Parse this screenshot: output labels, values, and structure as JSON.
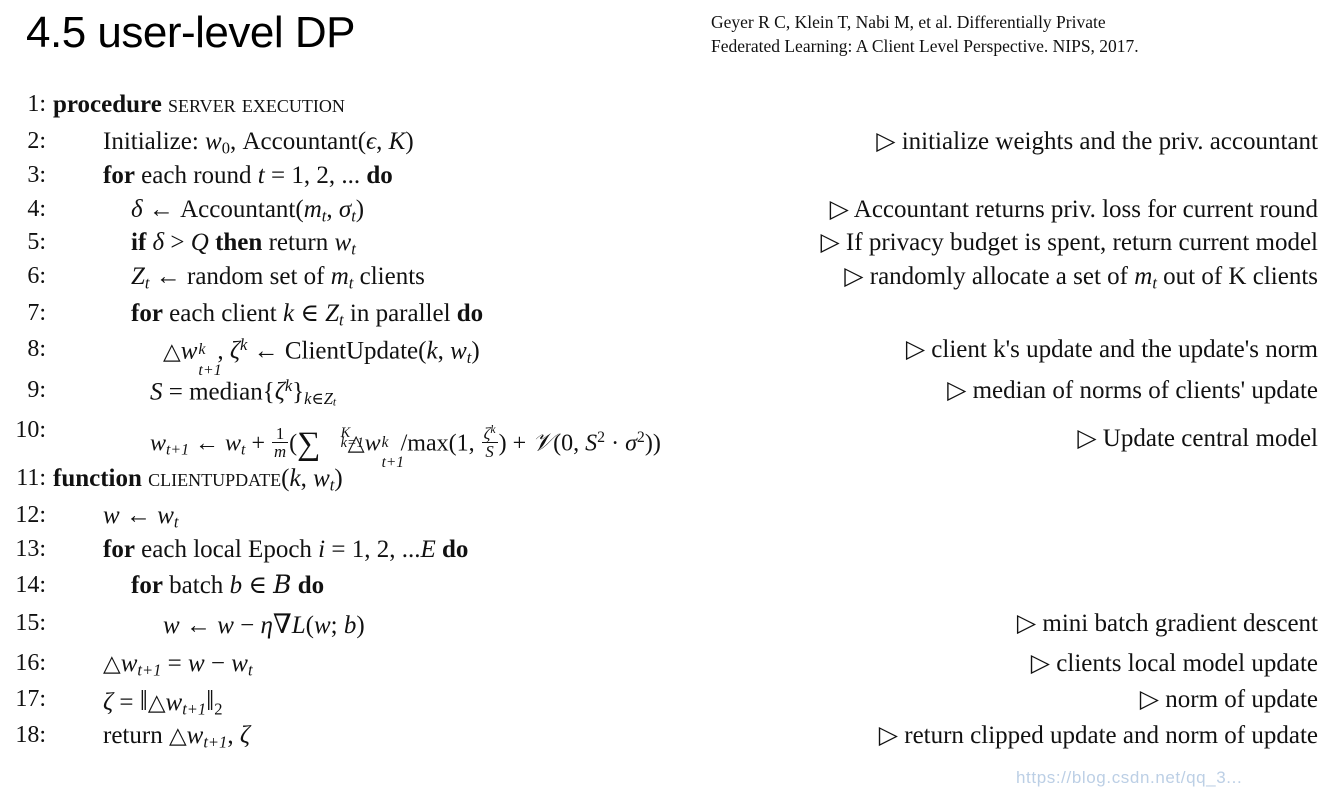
{
  "header": {
    "title": "4.5 user-level DP",
    "citation": [
      "Geyer R C, Klein T, Nabi M, et al. Differentially Private",
      "Federated Learning: A Client Level Perspective. NIPS, 2017."
    ]
  },
  "watermark": {
    "text": "https://blog.csdn.net/qq_3..."
  },
  "algorithm": {
    "name": "Server execution / ClientUpdate",
    "comment_marker": "▷",
    "lines": [
      {
        "no": "1:",
        "indent": 53,
        "code_text": "procedure Server execution",
        "comment": ""
      },
      {
        "no": "2:",
        "indent": 103,
        "code_text": "Initialize: w0, Accountant(ϵ, K)",
        "comment": "▷ initialize weights and the priv. accountant"
      },
      {
        "no": "3:",
        "indent": 103,
        "code_text": "for each round t = 1, 2, ... do",
        "comment": ""
      },
      {
        "no": "4:",
        "indent": 131,
        "code_text": "δ ← Accountant(mt, σt)",
        "comment": "▷ Accountant returns priv. loss for current round"
      },
      {
        "no": "5:",
        "indent": 131,
        "code_text": "if δ > Q then return wt",
        "comment": "▷ If privacy budget is spent, return current model"
      },
      {
        "no": "6:",
        "indent": 131,
        "code_text": "Zt ← random set of mt clients",
        "comment": "▷ randomly allocate a set of mt out of K clients"
      },
      {
        "no": "7:",
        "indent": 131,
        "code_text": "for each client k ∈ Zt in parallel do",
        "comment": ""
      },
      {
        "no": "8:",
        "indent": 163,
        "code_text": "△wkt+1, ζk ← ClientUpdate(k, wt)",
        "comment": "▷ client k's update and the update's norm"
      },
      {
        "no": "9:",
        "indent": 150,
        "code_text": "S = median{ζk}k∈Zt",
        "comment": "▷ median of norms of clients' update"
      },
      {
        "no": "10:",
        "indent": 150,
        "code_text": "wt+1 ← wt + 1/m(∑Kk=1 △wkt+1/max(1, ζk/S) + N(0, S2 · σ2))",
        "comment": "▷ Update central model"
      },
      {
        "no": "11:",
        "indent": 53,
        "code_text": "function ClientUpdate(k, wt)",
        "comment": ""
      },
      {
        "no": "12:",
        "indent": 103,
        "code_text": "w ← wt",
        "comment": ""
      },
      {
        "no": "13:",
        "indent": 103,
        "code_text": "for each local Epoch i = 1, 2, ...E do",
        "comment": ""
      },
      {
        "no": "14:",
        "indent": 131,
        "code_text": "for batch b ∈ B do",
        "comment": ""
      },
      {
        "no": "15:",
        "indent": 163,
        "code_text": "w ← w − η∇L(w; b)",
        "comment": "▷ mini batch gradient descent"
      },
      {
        "no": "16:",
        "indent": 103,
        "code_text": "△wt+1 = w − wt",
        "comment": "▷ clients local model update"
      },
      {
        "no": "17:",
        "indent": 103,
        "code_text": "ζ = ‖△wt+1‖2",
        "comment": "▷ norm of update"
      },
      {
        "no": "18:",
        "indent": 103,
        "code_text": "return △wt+1, ζ",
        "comment": "▷ return clipped update and norm of update"
      }
    ]
  }
}
